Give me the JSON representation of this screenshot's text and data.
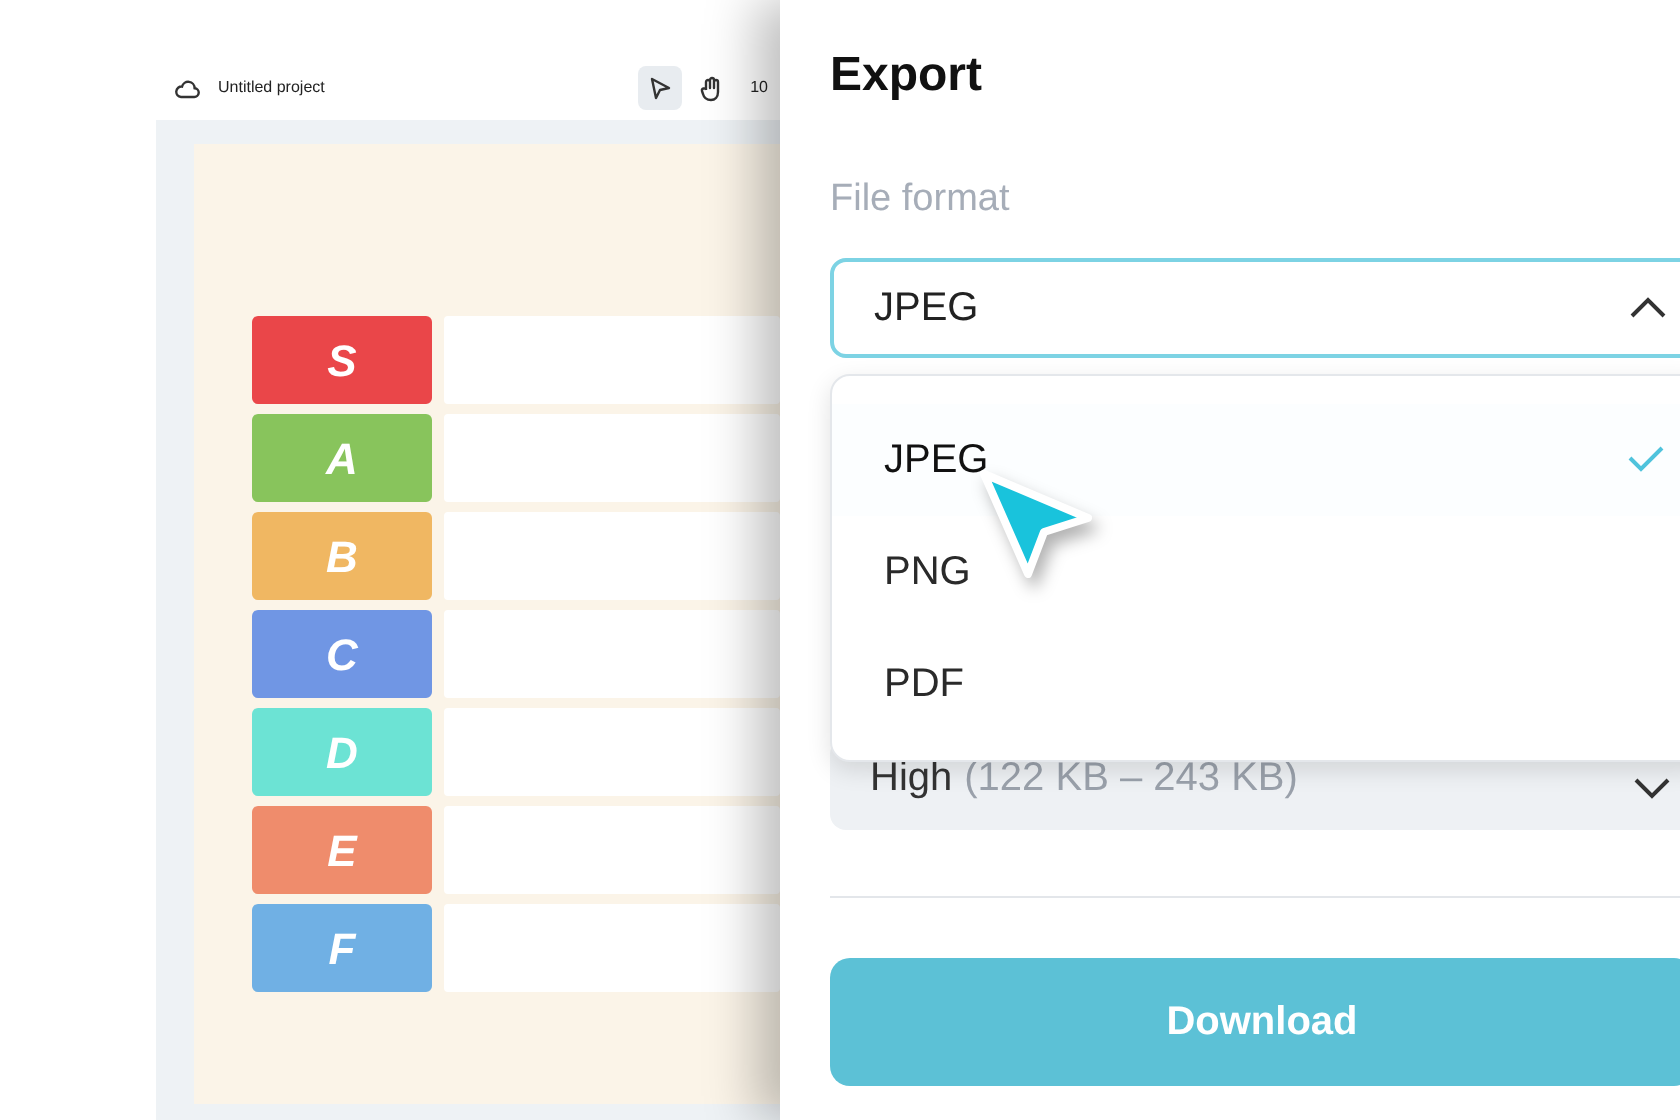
{
  "editor": {
    "project_title": "Untitled project",
    "tools": [
      {
        "kind": "pointer",
        "selected": true
      },
      {
        "kind": "hand",
        "selected": false
      }
    ],
    "zoom": "10",
    "tiers": [
      {
        "label": "S",
        "color": "#ea4649"
      },
      {
        "label": "A",
        "color": "#88c45c"
      },
      {
        "label": "B",
        "color": "#f0b762"
      },
      {
        "label": "C",
        "color": "#7096e4"
      },
      {
        "label": "D",
        "color": "#6ce3d4"
      },
      {
        "label": "E",
        "color": "#ef8c6c"
      },
      {
        "label": "F",
        "color": "#70b0e4"
      }
    ]
  },
  "export_panel": {
    "title": "Export",
    "file_format_label": "File format",
    "file_format": {
      "value": "JPEG",
      "expanded": true
    },
    "options": [
      {
        "label": "JPEG",
        "selected": true
      },
      {
        "label": "PNG",
        "selected": false
      },
      {
        "label": "PDF",
        "selected": false
      }
    ],
    "quality": {
      "value": "High",
      "detail": "(122 KB – 243 KB)"
    },
    "download_button": "Download"
  }
}
